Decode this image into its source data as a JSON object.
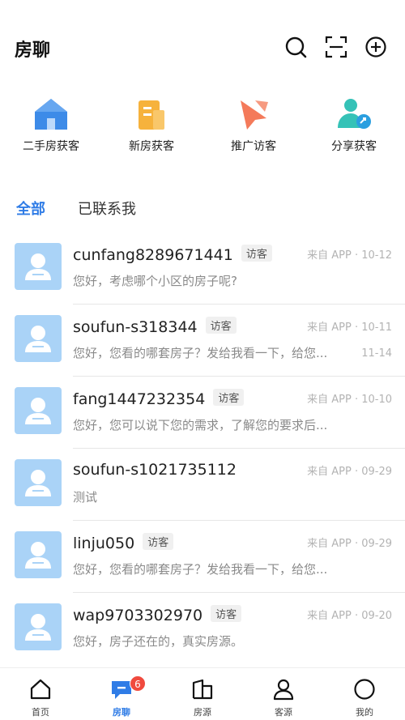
{
  "header": {
    "title": "房聊",
    "icons": [
      "search-icon",
      "scan-icon",
      "add-icon"
    ]
  },
  "shortcuts": [
    {
      "label": "二手房获客",
      "icon": "house-icon",
      "color": "#3d8be8"
    },
    {
      "label": "新房获客",
      "icon": "building-icon",
      "color": "#f6b23c"
    },
    {
      "label": "推广访客",
      "icon": "promote-icon",
      "color": "#f47a5a"
    },
    {
      "label": "分享获客",
      "icon": "share-user-icon",
      "color": "#35c2b7"
    }
  ],
  "tabs": {
    "all": "全部",
    "contacted": "已联系我",
    "active_color": "#2f7ce6"
  },
  "conversations": [
    {
      "name": "cunfang8289671441",
      "badge": "访客",
      "source": "来自 APP · 10-12",
      "message": "您好，考虑哪个小区的房子呢?",
      "time2": ""
    },
    {
      "name": "soufun-s318344",
      "badge": "访客",
      "source": "来自 APP · 10-11",
      "message": "您好，您看的哪套房子？发给我看一下，给您...",
      "time2": "11-14"
    },
    {
      "name": "fang1447232354",
      "badge": "访客",
      "source": "来自 APP · 10-10",
      "message": "您好，您可以说下您的需求，了解您的要求后...",
      "time2": ""
    },
    {
      "name": "soufun-s1021735112",
      "badge": "",
      "source": "来自 APP · 09-29",
      "message": "测试",
      "time2": ""
    },
    {
      "name": "linju050",
      "badge": "访客",
      "source": "来自 APP · 09-29",
      "message": "您好，您看的哪套房子？发给我看一下，给您...",
      "time2": ""
    },
    {
      "name": "wap9703302970",
      "badge": "访客",
      "source": "来自 APP · 09-20",
      "message": "您好，房子还在的，真实房源。",
      "time2": ""
    }
  ],
  "bottom_nav": [
    {
      "label": "首页",
      "icon": "home-icon",
      "active": false
    },
    {
      "label": "房聊",
      "icon": "chat-icon",
      "active": true,
      "badge": "6"
    },
    {
      "label": "房源",
      "icon": "listing-icon",
      "active": false
    },
    {
      "label": "客源",
      "icon": "customer-icon",
      "active": false
    },
    {
      "label": "我的",
      "icon": "profile-icon",
      "active": false
    }
  ]
}
